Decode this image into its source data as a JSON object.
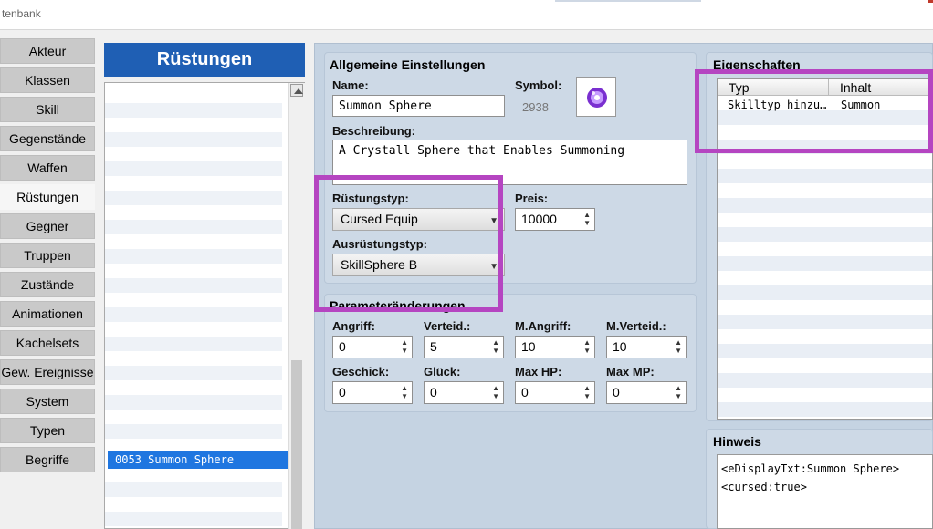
{
  "window": {
    "title": "tenbank"
  },
  "nav": {
    "items": [
      {
        "label": "Akteur"
      },
      {
        "label": "Klassen"
      },
      {
        "label": "Skill"
      },
      {
        "label": "Gegenstände"
      },
      {
        "label": "Waffen"
      },
      {
        "label": "Rüstungen"
      },
      {
        "label": "Gegner"
      },
      {
        "label": "Truppen"
      },
      {
        "label": "Zustände"
      },
      {
        "label": "Animationen"
      },
      {
        "label": "Kachelsets"
      },
      {
        "label": "Gew. Ereignisse"
      },
      {
        "label": "System"
      },
      {
        "label": "Typen"
      },
      {
        "label": "Begriffe"
      }
    ],
    "active": "Rüstungen"
  },
  "list": {
    "header": "Rüstungen",
    "selected_item": "0053 Summon Sphere"
  },
  "general": {
    "title": "Allgemeine Einstellungen",
    "name_label": "Name:",
    "name_value": "Summon Sphere",
    "symbol_label": "Symbol:",
    "symbol_index": "2938",
    "desc_label": "Beschreibung:",
    "desc_value": "A Crystall Sphere that Enables Summoning",
    "armor_type_label": "Rüstungstyp:",
    "armor_type_value": "Cursed Equip",
    "price_label": "Preis:",
    "price_value": "10000",
    "equip_type_label": "Ausrüstungstyp:",
    "equip_type_value": "SkillSphere B"
  },
  "params": {
    "title": "Parameteränderungen",
    "fields": [
      {
        "label": "Angriff:",
        "value": "0"
      },
      {
        "label": "Verteid.:",
        "value": "5"
      },
      {
        "label": "M.Angriff:",
        "value": "10"
      },
      {
        "label": "M.Verteid.:",
        "value": "10"
      },
      {
        "label": "Geschick:",
        "value": "0"
      },
      {
        "label": "Glück:",
        "value": "0"
      },
      {
        "label": "Max HP:",
        "value": "0"
      },
      {
        "label": "Max MP:",
        "value": "0"
      }
    ]
  },
  "traits": {
    "title": "Eigenschaften",
    "columns": [
      "Typ",
      "Inhalt"
    ],
    "rows": [
      {
        "type": "Skilltyp hinzu…",
        "content": "Summon"
      }
    ]
  },
  "note": {
    "title": "Hinweis",
    "lines": [
      "<eDisplayTxt:Summon Sphere>",
      "<cursed:true>"
    ]
  },
  "colors": {
    "highlight": "#b545c1",
    "list_header": "#1f5fb4",
    "selection": "#1f76e0",
    "panel": "#cdd9e6"
  }
}
